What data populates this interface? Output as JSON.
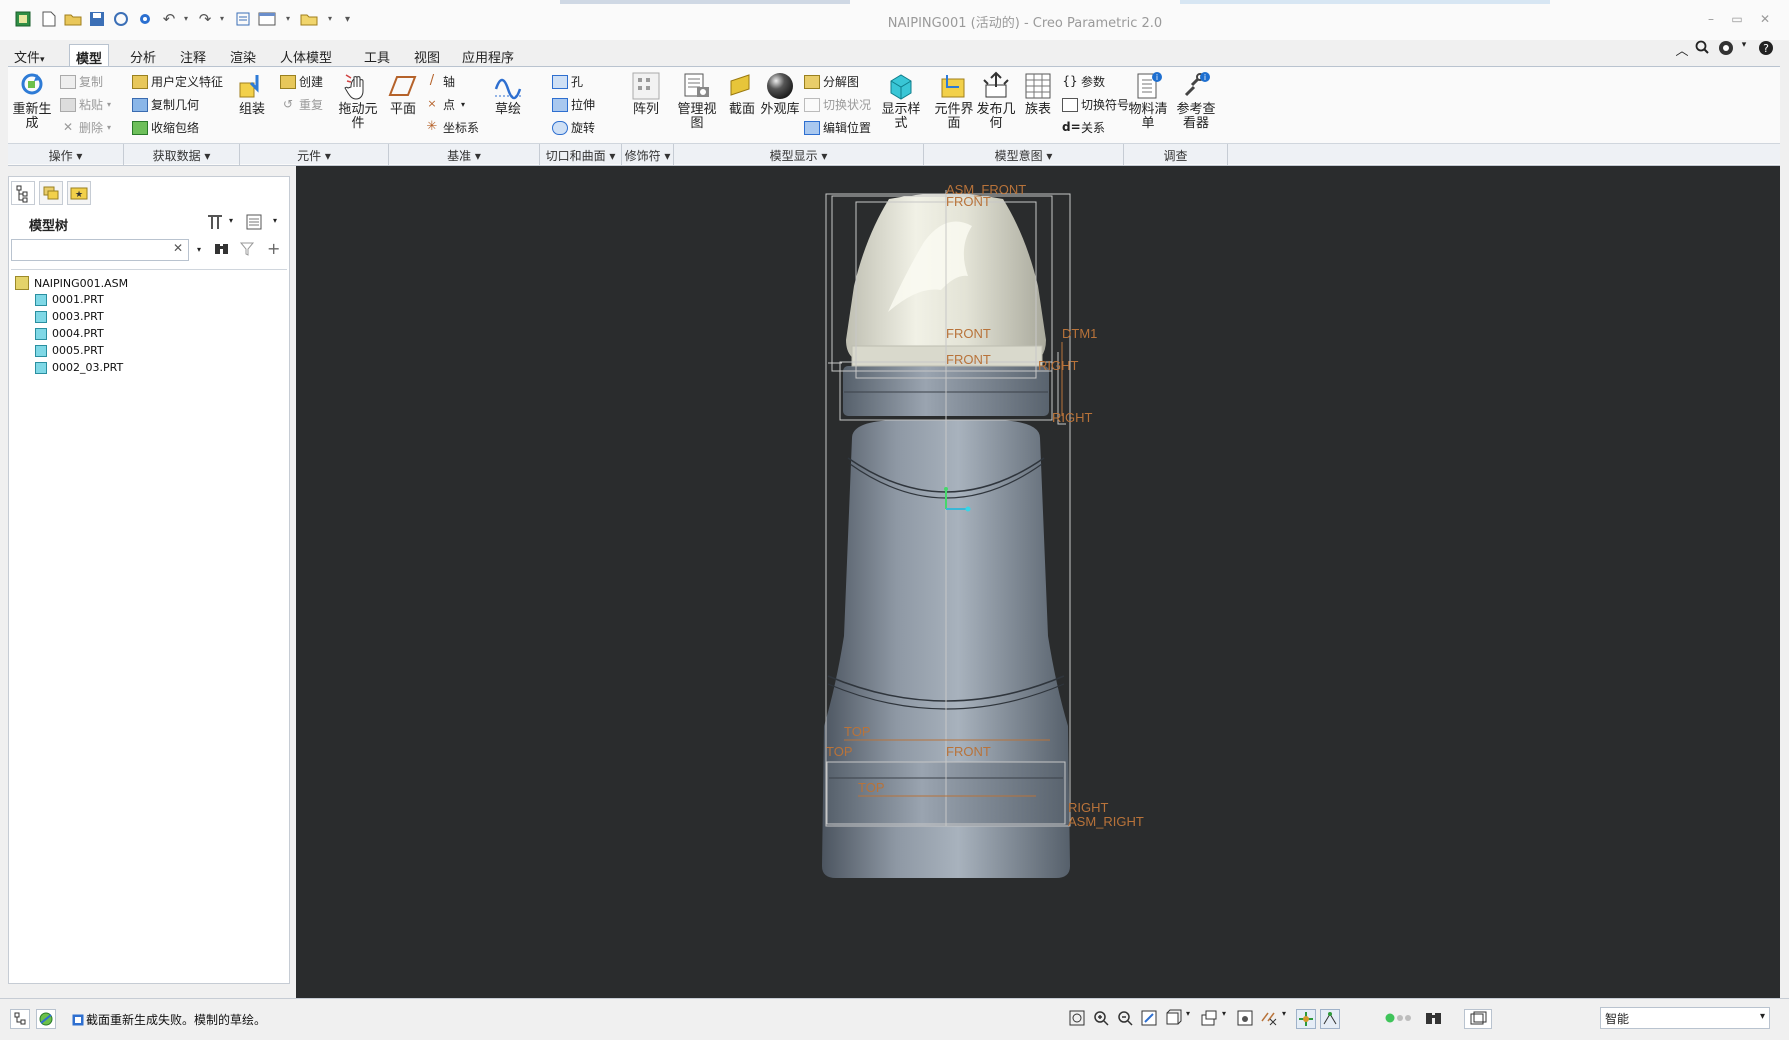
{
  "window": {
    "title": "NAIPING001 (活动的) - Creo Parametric 2.0"
  },
  "menu": {
    "tabs": [
      {
        "label": "文件",
        "caret": "▾"
      },
      {
        "label": "模型"
      },
      {
        "label": "分析"
      },
      {
        "label": "注释"
      },
      {
        "label": "渲染"
      },
      {
        "label": "人体模型"
      },
      {
        "label": "工具"
      },
      {
        "label": "视图"
      },
      {
        "label": "应用程序"
      }
    ]
  },
  "ribbon": {
    "regenerate": "重新生成",
    "copy": "复制",
    "paste": "粘贴",
    "delete": "删除",
    "udf": "用户定义特征",
    "copy_geom": "复制几何",
    "shrinkwrap": "收缩包络",
    "assemble": "组装",
    "create": "创建",
    "repeat": "重复",
    "drag": "拖动元件",
    "plane": "平面",
    "axis": "轴",
    "point": "点",
    "csys": "坐标系",
    "sketch": "草绘",
    "hole": "孔",
    "extrude": "拉伸",
    "revolve": "旋转",
    "pattern": "阵列",
    "manage_views": "管理视图",
    "section": "截面",
    "appearance": "外观库",
    "explode": "分解图",
    "toggle_state": "切换状况",
    "edit_position": "编辑位置",
    "display_style": "显示样式",
    "component_interface": "元件界面",
    "publish_geom": "发布几何",
    "family_table": "族表",
    "parameters": "参数",
    "switch_symbols": "切换符号",
    "relations": "关系",
    "bom": "物料清单",
    "ref_viewer": "参考查看器"
  },
  "groups": [
    {
      "label": "操作 ▾"
    },
    {
      "label": "获取数据 ▾"
    },
    {
      "label": "元件 ▾"
    },
    {
      "label": "基准 ▾"
    },
    {
      "label": "切口和曲面 ▾"
    },
    {
      "label": "修饰符 ▾"
    },
    {
      "label": "模型显示 ▾"
    },
    {
      "label": "模型意图 ▾"
    },
    {
      "label": "调查"
    }
  ],
  "model_tree": {
    "title": "模型树",
    "search_value": "",
    "root": "NAIPING001.ASM",
    "parts": [
      "0001.PRT",
      "0003.PRT",
      "0004.PRT",
      "0005.PRT",
      "0002_03.PRT"
    ]
  },
  "datum_labels": {
    "asm_front": "ASM_FRONT",
    "front_top": "FRONT",
    "front1": "FRONT",
    "front2": "FRONT",
    "dtm1": "DTM1",
    "right1": "RIGHT",
    "right2": "RIGHT",
    "top1": "TOP",
    "top2": "TOP",
    "top3": "TOP",
    "front_bottom": "FRONT",
    "right_bottom": "RIGHT",
    "asm_right": "ASM_RIGHT"
  },
  "status": {
    "message": "截面重新生成失败。模制的草绘。",
    "filter": "智能"
  },
  "colors": {
    "accent": "#1e6fd0",
    "datum": "#b8733a",
    "background": "#2a2c2d"
  }
}
